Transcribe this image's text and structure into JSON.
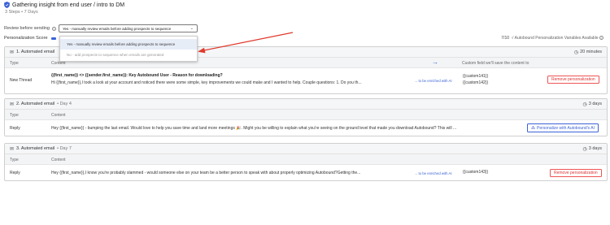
{
  "header": {
    "title": "Gathering insight from end user / intro to DM",
    "subtitle": "3 Steps  •  7 Days"
  },
  "review": {
    "label": "Review before sending",
    "selected": "Yes - manually review emails before adding prospects to sequence"
  },
  "dropdown": {
    "options": [
      "Yes - manually review emails before adding prospects to sequence",
      "No - add prospects to sequence when emails are generated"
    ]
  },
  "score": {
    "label": "Personalization Score",
    "value": "7/10",
    "note": "√ Autobound Personalization Variables Available"
  },
  "columns": {
    "type": "Type",
    "content": "Content",
    "custom_field": "Custom field we'll save the content to"
  },
  "cards": [
    {
      "title": "1. Automated email",
      "day": "",
      "time": "20 minutes",
      "row_type": "New Thread",
      "subject": "{{first_name}} <> {{sender.first_name}}: Key Autobound User - Reason for downloading?",
      "body": "Hi {{first_name}},I took a look at your account and noticed there were some simple, key improvements we could make and I wanted to help. Couple questions: 1. Do you th...",
      "enrich": "→ to be enriched with AI",
      "vars": [
        "{{custom141}}",
        "{{custom142}}"
      ],
      "button": "Remove personalization"
    },
    {
      "title": "2. Automated email",
      "day": "•  Day 4",
      "time": "3 days",
      "row_type": "Reply",
      "body": "Hey {{first_name}} - bumping the last email. Would love to help you save time and land more meetings 🎉. Might you be willing to explain what you're seeing on the ground level that made you download Autobound? This will ...",
      "button": "Personalize with Autobound's AI"
    },
    {
      "title": "3. Automated email",
      "day": "•  Day 7",
      "time": "3 days",
      "row_type": "Reply",
      "body": "Hey {{first_name}},I know you're probably slammed - would someone else on your team be a better person to speak with about properly optimizing Autobound?Getting the...",
      "enrich": "→ to be enriched with AI",
      "vars": [
        "{{custom143}}"
      ],
      "button": "Remove personalization"
    }
  ],
  "colors": {
    "accent": "#3b62d6",
    "danger": "#dd3333",
    "arrow": "#e03a2c"
  }
}
